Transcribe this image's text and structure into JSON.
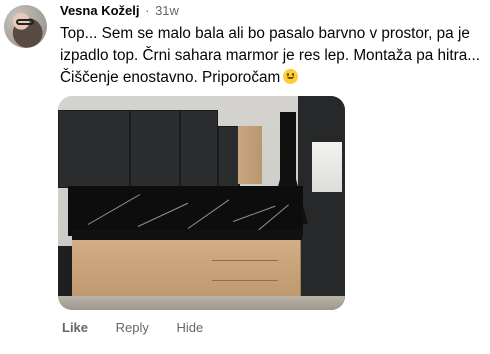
{
  "comment": {
    "author": "Vesna Koželj",
    "time": "31w",
    "text": "Top... Sem se malo bala ali bo pasalo barvno v prostor, pa je izpadlo top. Črni sahara marmor je res lep. Montaža pa hitra... Čiščenje enostavno. Priporočam",
    "emoji": "smiling-face-emoji"
  },
  "actions": {
    "like": "Like",
    "reply": "Reply",
    "hide": "Hide"
  }
}
